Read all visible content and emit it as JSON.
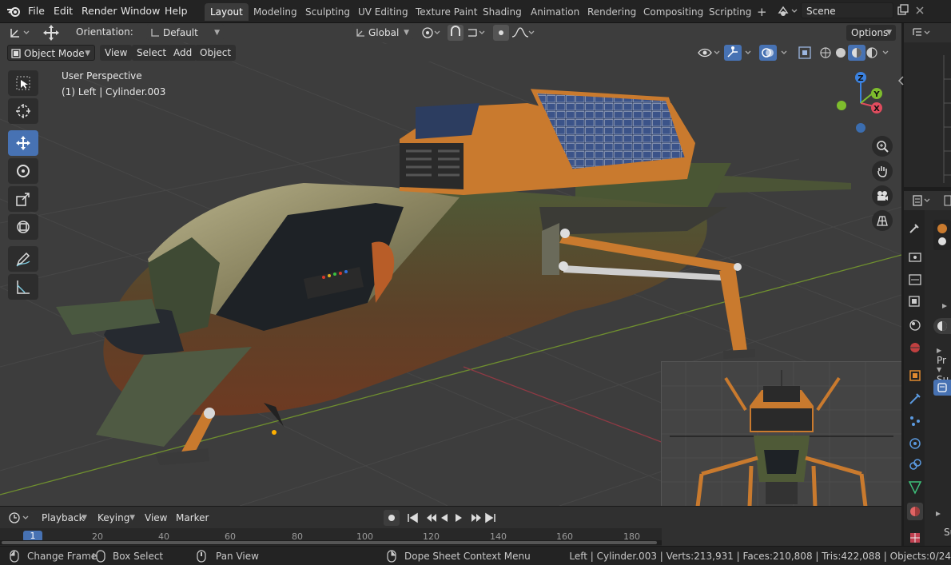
{
  "menubar": {
    "items": [
      "File",
      "Edit",
      "Render",
      "Window",
      "Help"
    ]
  },
  "workspaces": {
    "tabs": [
      "Layout",
      "Modeling",
      "Sculpting",
      "UV Editing",
      "Texture Paint",
      "Shading",
      "Animation",
      "Rendering",
      "Compositing",
      "Scripting"
    ],
    "active": "Layout",
    "add_label": "+"
  },
  "scene": {
    "name": "Scene"
  },
  "tool_header": {
    "orientation_label": "Orientation:",
    "orientation_value": "Default",
    "transform_orientation": "Global",
    "options_label": "Options"
  },
  "viewport_header": {
    "mode": "Object Mode",
    "menus": [
      "View",
      "Select",
      "Add",
      "Object"
    ]
  },
  "viewport": {
    "perspective_label": "User Perspective",
    "object_label": "(1) Left | Cylinder.003",
    "gizmo_axes": {
      "z": "Z",
      "y": "Y",
      "x": "X"
    }
  },
  "timeline": {
    "menus": [
      "Playback",
      "Keying",
      "View",
      "Marker"
    ],
    "current_frame": "1",
    "ticks": [
      "20",
      "40",
      "60",
      "80",
      "100",
      "120",
      "140",
      "160",
      "180"
    ]
  },
  "properties": {
    "row1": "Pr",
    "row2": "Su",
    "row3": "Su"
  },
  "statusbar": {
    "change_frame": "Change Frame",
    "box_select": "Box Select",
    "pan_view": "Pan View",
    "dope_sheet_menu": "Dope Sheet Context Menu",
    "stats": "Left | Cylinder.003 | Verts:213,931 | Faces:210,808 | Tris:422,088 | Objects:0/24"
  },
  "colors": {
    "accent": "#4772b3",
    "ship_orange": "#c97a2e",
    "ship_green": "#4a5634",
    "ship_rust": "#6e3a22",
    "axis_x": "#e04c5e",
    "axis_y": "#7ebd2d",
    "axis_z": "#3b82e0"
  }
}
